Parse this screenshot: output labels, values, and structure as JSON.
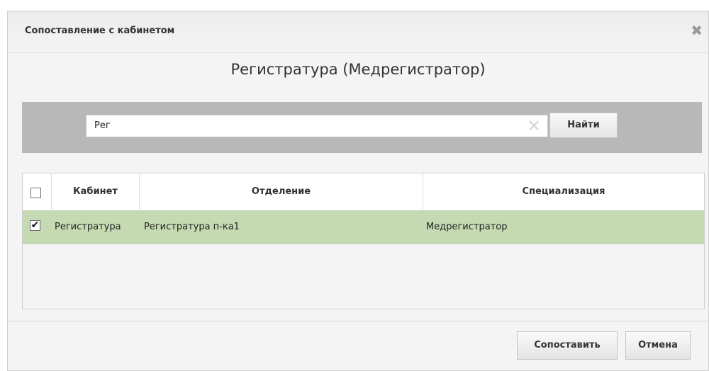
{
  "dialog": {
    "title": "Сопоставление с кабинетом",
    "close_glyph": "✖",
    "subtitle": "Регистратура (Медрегистратор)"
  },
  "search": {
    "value": "Рег",
    "clear_glyph": "✕",
    "find_label": "Найти"
  },
  "table": {
    "headers": {
      "room": "Кабинет",
      "department": "Отделение",
      "specialization": "Специализация"
    },
    "rows": [
      {
        "checked": true,
        "check_glyph": "✔",
        "room": "Регистратура",
        "department": "Регистратура п-ка1",
        "specialization": "Медрегистратор"
      }
    ],
    "selected_row_color": "#c5dab2"
  },
  "footer": {
    "map_label": "Сопоставить",
    "cancel_label": "Отмена"
  }
}
